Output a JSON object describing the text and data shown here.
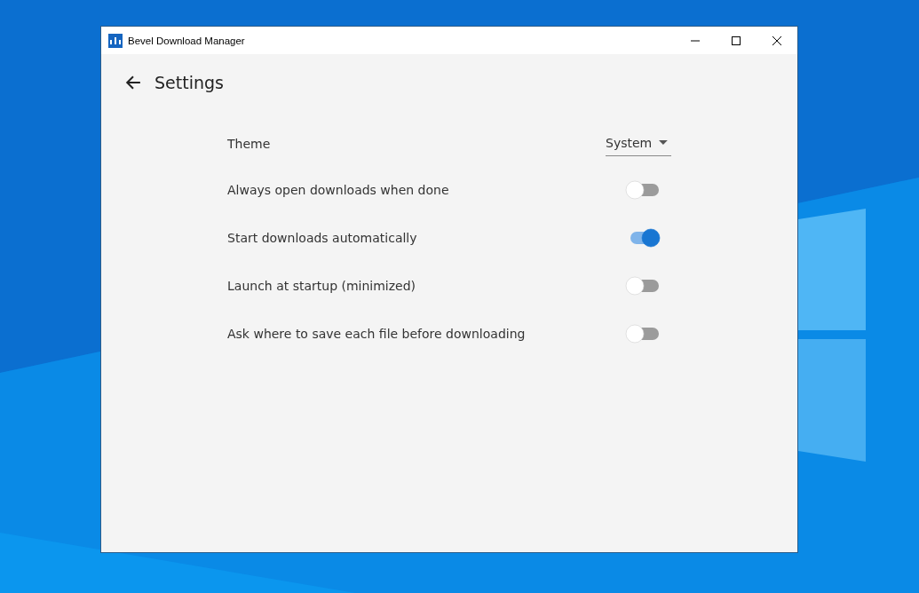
{
  "window": {
    "title": "Bevel Download Manager"
  },
  "page": {
    "title": "Settings"
  },
  "settings": [
    {
      "kind": "select",
      "label": "Theme",
      "value": "System"
    },
    {
      "kind": "toggle",
      "label": "Always open downloads when done",
      "on": false
    },
    {
      "kind": "toggle",
      "label": "Start downloads automatically",
      "on": true
    },
    {
      "kind": "toggle",
      "label": "Launch at startup (minimized)",
      "on": false
    },
    {
      "kind": "toggle",
      "label": "Ask where to save each file before downloading",
      "on": false
    }
  ]
}
